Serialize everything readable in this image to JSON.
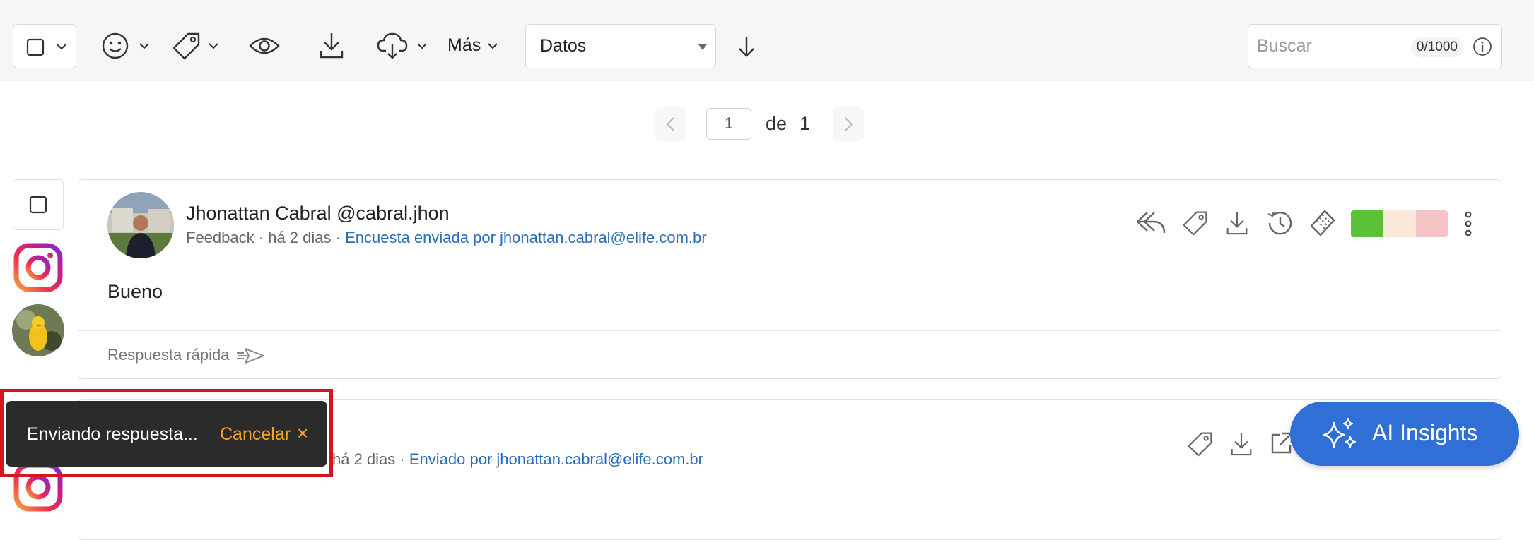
{
  "toolbar": {
    "more_label": "Más",
    "sort_select_value": "Datos",
    "search_placeholder": "Buscar",
    "search_counter": "0/1000"
  },
  "pagination": {
    "current_page": "1",
    "of_label": "de",
    "total_pages": "1"
  },
  "posts": [
    {
      "author": "Jhonattan Cabral @cabral.jhon",
      "type": "Feedback",
      "time": "há 2 dias",
      "source_link": "Encuesta enviada por jhonattan.cabral@elife.com.br",
      "body": "Bueno",
      "quick_reply_label": "Respuesta rápida",
      "sentiment_colors": [
        "#5bc238",
        "#fbeadb",
        "#f6c3c6"
      ]
    },
    {
      "time": "há 2 dias",
      "source_link": "Enviado por jhonattan.cabral@elife.com.br"
    }
  ],
  "toast": {
    "message": "Enviando respuesta...",
    "cancel_label": "Cancelar",
    "close_glyph": "×"
  },
  "ai_button": {
    "label": "AI Insights"
  },
  "colors": {
    "link": "#2a6ebb",
    "toast_bg": "#2b2b2b",
    "toast_accent": "#f3a52b",
    "ai_button": "#2f6fd6",
    "highlight_frame": "#d6161e"
  }
}
